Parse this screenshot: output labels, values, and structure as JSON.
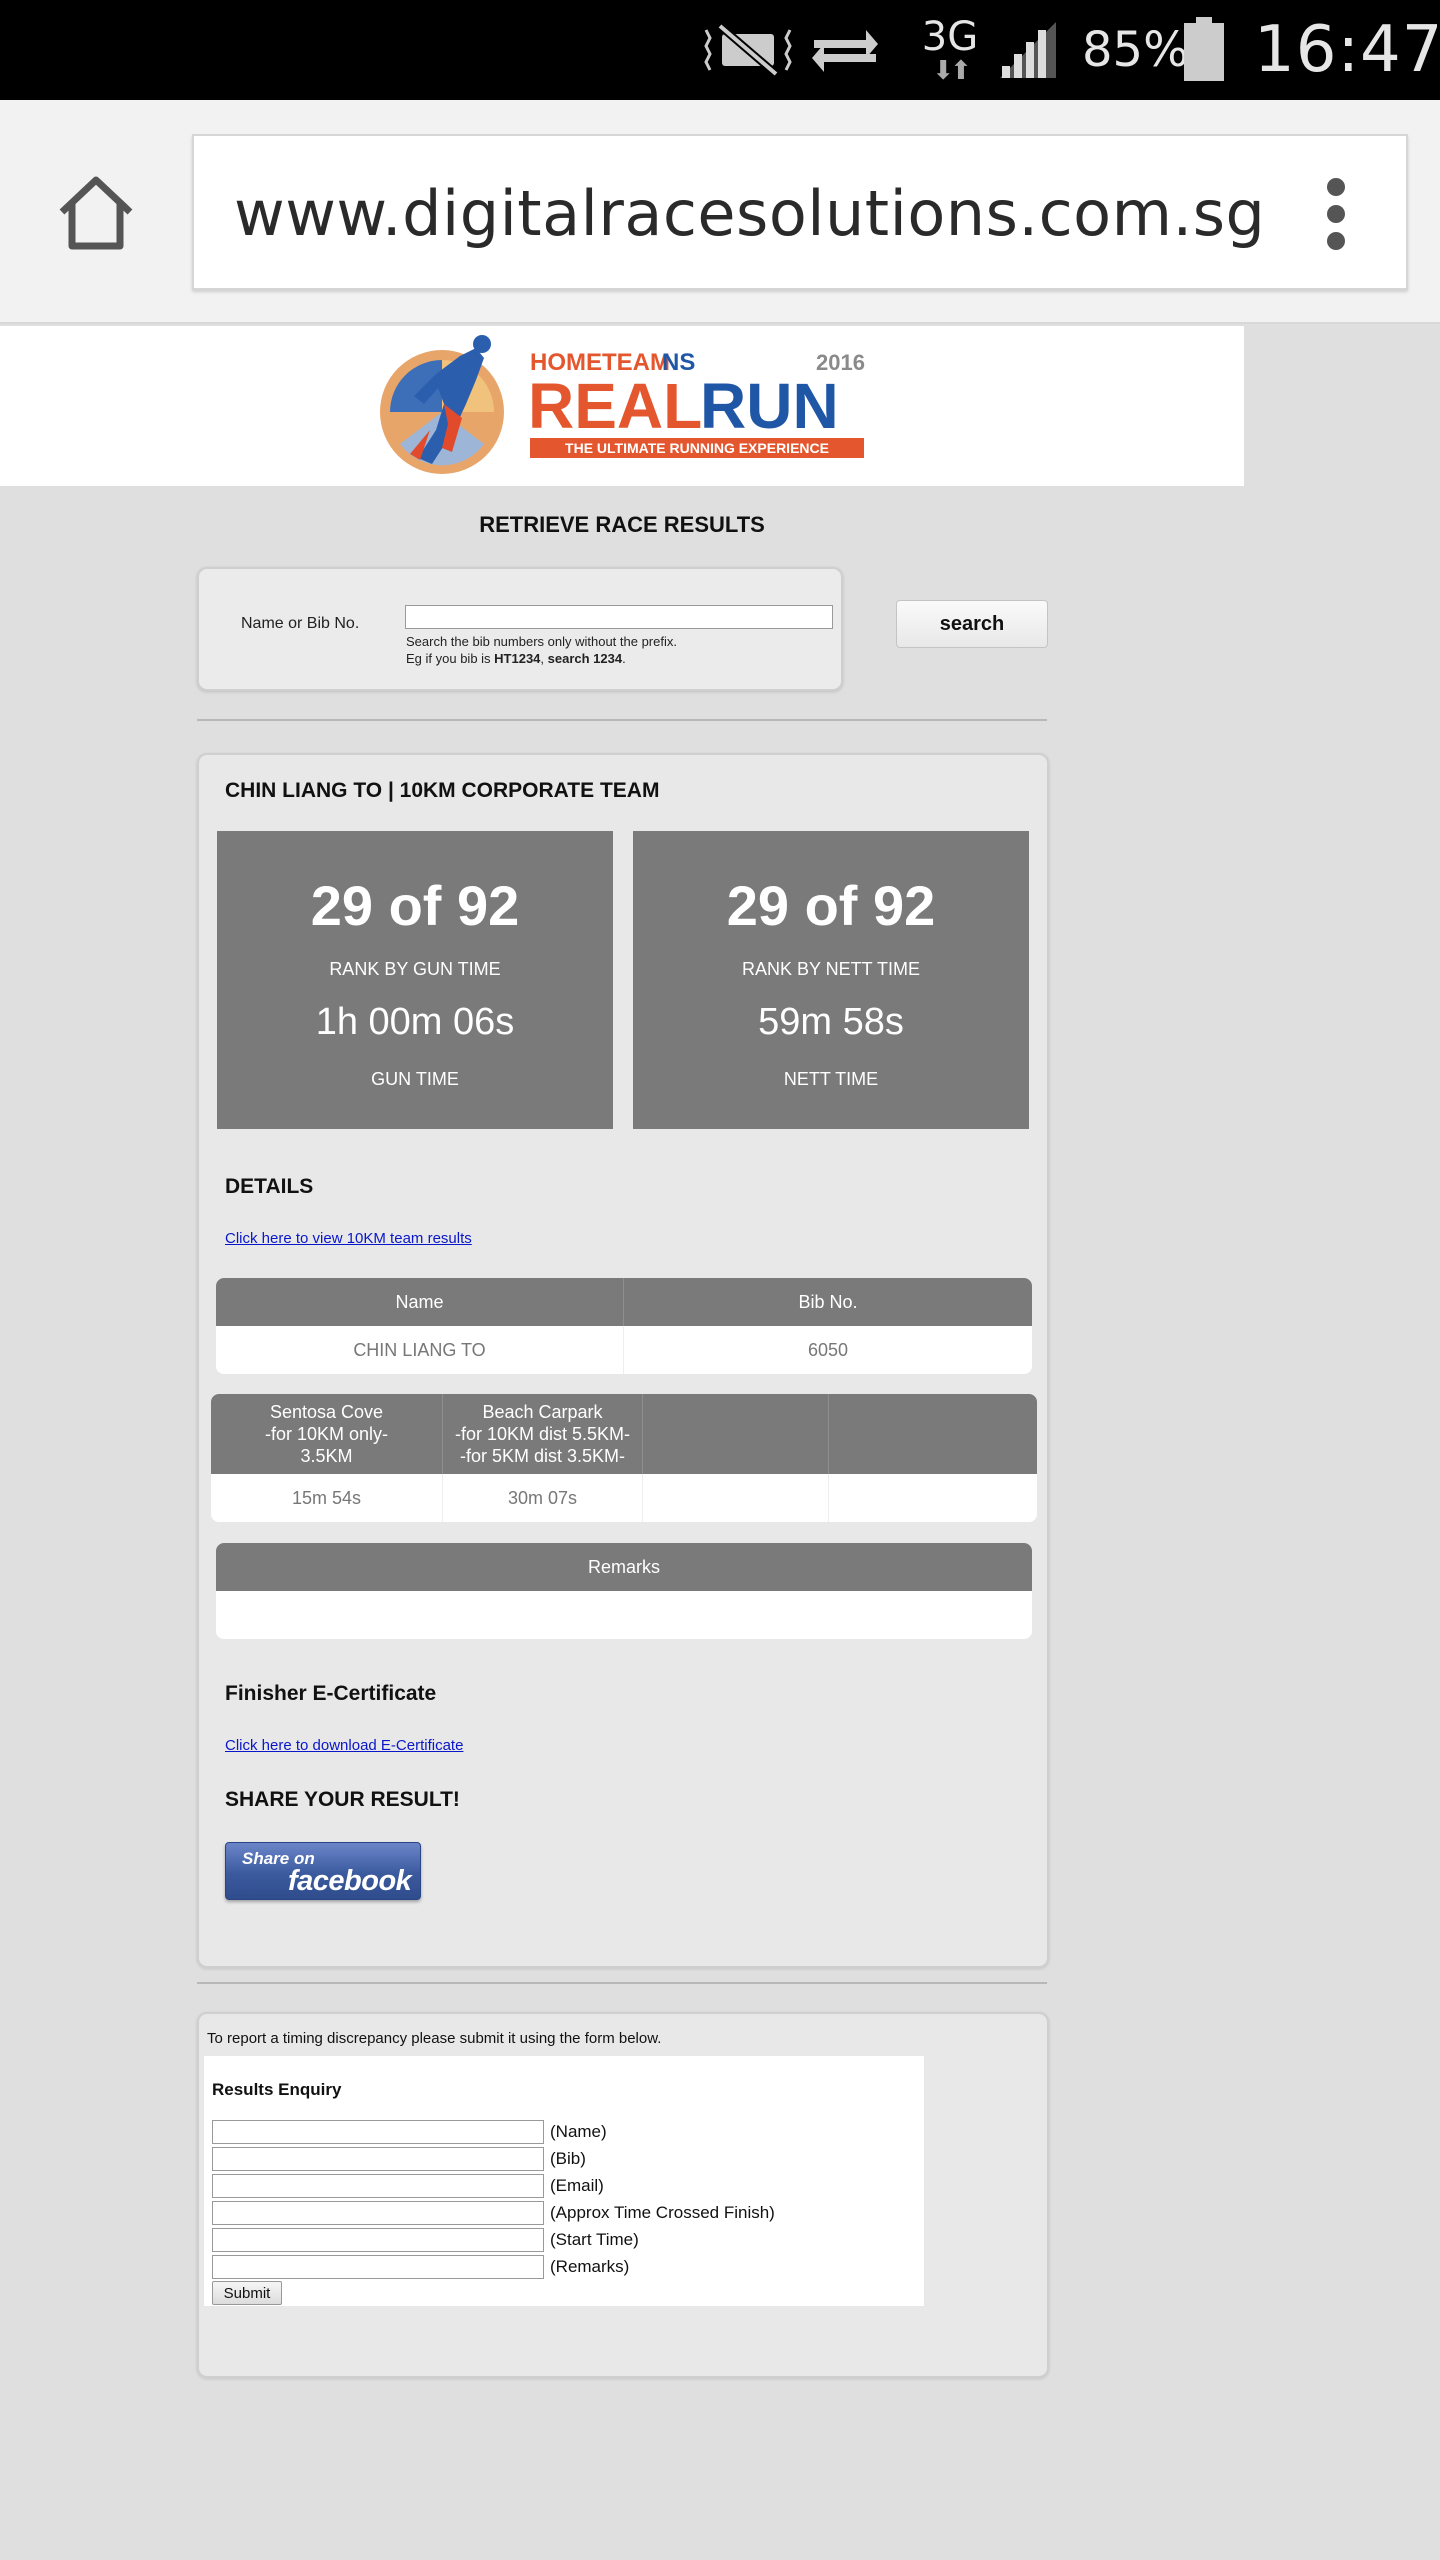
{
  "status_bar": {
    "network": "3G",
    "battery_percent": "85%",
    "time": "16:47",
    "icons": [
      "mute-vibrate-icon",
      "sync-arrows-icon",
      "network-3g-icon",
      "signal-strength-icon",
      "battery-icon"
    ]
  },
  "browser": {
    "url": "www.digitalracesolutions.com.sg",
    "icons": [
      "home-icon",
      "overflow-menu-icon"
    ]
  },
  "banner": {
    "brand": "HOMETEAMNS",
    "year": "2016",
    "event": "REAL RUN",
    "tagline": "THE ULTIMATE RUNNING EXPERIENCE",
    "colors": {
      "orange": "#e4572e",
      "blue": "#1f56a5",
      "grey": "#8a8a8a"
    }
  },
  "page": {
    "title": "RETRIEVE RACE RESULTS"
  },
  "search": {
    "label": "Name or Bib No.",
    "value": "",
    "hint_line1": "Search the bib numbers only without the prefix.",
    "hint_prefix": "Eg if you bib is ",
    "hint_example_bib": "HT1234",
    "hint_sep": ", ",
    "hint_example_search": "search 1234",
    "hint_end": ".",
    "button_label": "search"
  },
  "result": {
    "runner_title": "CHIN LIANG TO | 10KM CORPORATE TEAM",
    "gun": {
      "rank": "29 of 92",
      "rank_label": "RANK BY GUN TIME",
      "time": "1h 00m 06s",
      "time_label": "GUN TIME"
    },
    "nett": {
      "rank": "29 of 92",
      "rank_label": "RANK BY NETT TIME",
      "time": "59m 58s",
      "time_label": "NETT TIME"
    },
    "details_title": "DETAILS",
    "team_link": "Click here to view 10KM team results",
    "info_table": {
      "headers": [
        "Name",
        "Bib No."
      ],
      "row": [
        "CHIN LIANG TO",
        "6050"
      ]
    },
    "checkpoint_table": {
      "headers": [
        "Sentosa Cove\n-for 10KM only-\n3.5KM",
        "Beach Carpark\n-for 10KM dist 5.5KM-\n-for 5KM dist 3.5KM-",
        "",
        ""
      ],
      "row": [
        "15m 54s",
        "30m 07s",
        "",
        ""
      ]
    },
    "remarks_table": {
      "header": "Remarks",
      "value": ""
    },
    "certificate_title": "Finisher E-Certificate",
    "certificate_link": "Click here to download E-Certificate",
    "share_title": "SHARE YOUR RESULT!",
    "facebook": {
      "small": "Share on",
      "big": "facebook"
    }
  },
  "enquiry": {
    "note": "To report a timing discrepancy please submit it using the form below.",
    "title": "Results Enquiry",
    "fields": [
      {
        "label": "(Name)",
        "value": ""
      },
      {
        "label": "(Bib)",
        "value": ""
      },
      {
        "label": "(Email)",
        "value": ""
      },
      {
        "label": "(Approx Time Crossed Finish)",
        "value": ""
      },
      {
        "label": "(Start Time)",
        "value": ""
      },
      {
        "label": "(Remarks)",
        "value": ""
      }
    ],
    "submit_label": "Submit"
  }
}
